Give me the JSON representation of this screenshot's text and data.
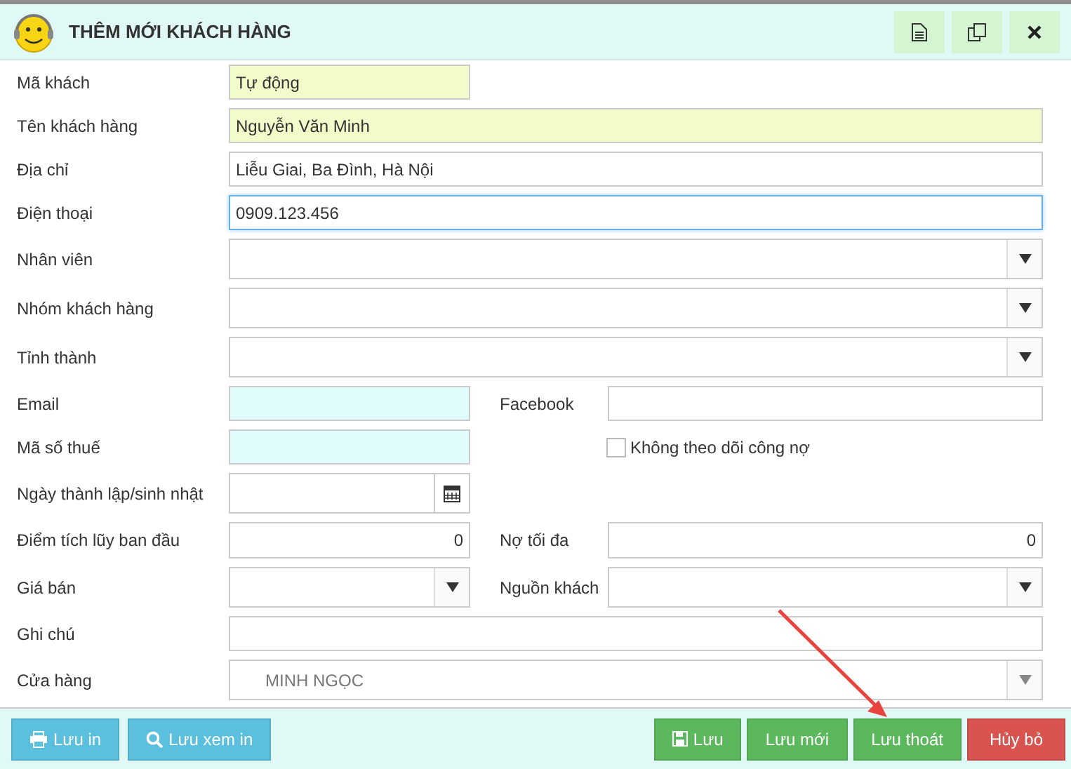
{
  "window": {
    "title": "THÊM MỚI KHÁCH HÀNG"
  },
  "rows": [
    {
      "label": "Mã khách",
      "kind": "text",
      "value": "Tự động"
    },
    {
      "label": "Tên khách hàng",
      "kind": "text",
      "value": "Nguyễn Văn Minh"
    },
    {
      "label": "Địa chỉ",
      "kind": "text",
      "value": "Liễu Giai, Ba Đình, Hà Nội"
    },
    {
      "label": "Điện thoại",
      "kind": "text",
      "value": "0909.123.456",
      "focused": true
    },
    {
      "label": "Nhân viên",
      "kind": "select"
    },
    {
      "label": "Nhóm khách hàng",
      "kind": "select"
    },
    {
      "label": "Tỉnh thành",
      "kind": "select"
    },
    {
      "label": "Email",
      "kind": "text",
      "right": {
        "label": "Facebook",
        "kind": "text"
      }
    },
    {
      "label": "Mã số thuế",
      "kind": "text",
      "right": {
        "label": "Không theo dõi công nợ",
        "kind": "checkbox",
        "checked": false
      }
    },
    {
      "label": "Ngày thành lập/sinh nhật",
      "kind": "date"
    },
    {
      "label": "Điểm tích lũy ban đầu",
      "kind": "number",
      "value": "0",
      "right": {
        "label": "Nợ tối đa",
        "kind": "number",
        "value": "0"
      }
    },
    {
      "label": "Giá bán",
      "kind": "select",
      "right": {
        "label": "Nguồn khách",
        "kind": "select"
      }
    },
    {
      "label": "Ghi chú",
      "kind": "text"
    },
    {
      "label": "Cửa hàng",
      "kind": "select",
      "value": "MINH NGỌC",
      "disabled": true
    }
  ],
  "footer": {
    "left": [
      {
        "label": "Lưu in",
        "kind": "info"
      },
      {
        "label": "Lưu xem in",
        "kind": "info"
      }
    ],
    "right": [
      {
        "label": "Lưu",
        "kind": "success"
      },
      {
        "label": "Lưu mới",
        "kind": "success"
      },
      {
        "label": "Lưu thoát",
        "kind": "success"
      },
      {
        "label": "Hủy bỏ",
        "kind": "danger"
      }
    ]
  }
}
